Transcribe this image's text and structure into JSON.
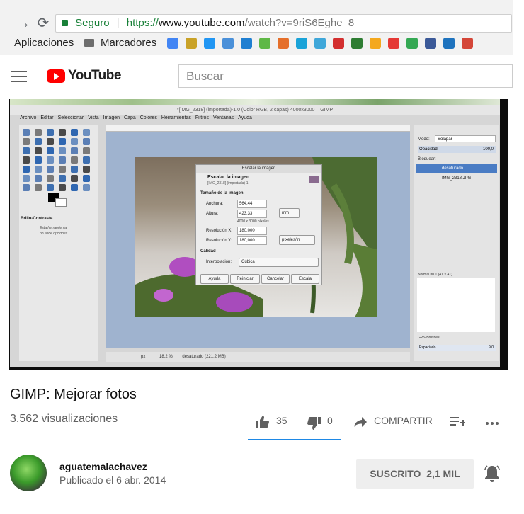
{
  "browser": {
    "secure_label": "Seguro",
    "url_scheme": "https://",
    "url_host": "www.youtube.com",
    "url_path": "/watch?v=9riS6Eghe_8",
    "bookmarks": [
      "Aplicaciones",
      "Marcadores"
    ],
    "bookmark_icon_colors": [
      "#4285f4",
      "#c9a227",
      "#2196f3",
      "#4a90d9",
      "#1f7fd1",
      "#5fb846",
      "#e56f2a",
      "#1aa3d8",
      "#3fa7d9",
      "#d32f2f",
      "#2e7d32",
      "#f4a81d",
      "#e53935",
      "#34a853",
      "#3b5998",
      "#1e73be",
      "#d44638"
    ]
  },
  "youtube": {
    "brand": "YouTube",
    "search_placeholder": "Buscar"
  },
  "gimp": {
    "window_title": "*[IMG_2318] (importada)-1.0 (Color RGB, 2 capas) 4000x3000 – GIMP",
    "menu": [
      "Archivo",
      "Editar",
      "Seleccionar",
      "Vista",
      "Imagen",
      "Capa",
      "Colores",
      "Herramientas",
      "Filtros",
      "Ventanas",
      "Ayuda"
    ],
    "tool_options_title": "Brillo-Contraste",
    "tool_options_note": [
      "Esta herramienta",
      "no tiene opciones."
    ],
    "dialog": {
      "title": "Escalar la imagen",
      "heading": "Escalar la imagen",
      "sub": "[IMG_2318] (importada)-1",
      "section_size": "Tamaño de la imagen",
      "width_label": "Anchura:",
      "width_value": "564,44",
      "height_label": "Altura:",
      "height_value": "423,33",
      "unit": "mm",
      "pixels_note": "4000 x 3000 píxeles",
      "xres_label": "Resolución X:",
      "xres_value": "180,000",
      "yres_label": "Resolución Y:",
      "yres_value": "180,000",
      "res_unit": "píxeles/in",
      "section_quality": "Calidad",
      "interp_label": "Interpolación:",
      "interp_value": "Cúbica",
      "buttons": [
        "Ayuda",
        "Reiniciar",
        "Cancelar",
        "Escala"
      ]
    },
    "layers": {
      "mode_label": "Modo:",
      "mode_value": "Solapar",
      "opacity_label": "Opacidad",
      "opacity_value": "100,0",
      "lock_label": "Bloquear:",
      "items": [
        "desaturado",
        "IMG_2318.JPG"
      ]
    },
    "brush_label": "Normal hb 1 (41 × 41)",
    "brush_set": "GPS-Brushes",
    "spacing_label": "Espaciado",
    "spacing_value": "9,0",
    "status_unit": "px",
    "status_zoom": "18,2 %",
    "status_text": "desaturado (221,2 MB)"
  },
  "video": {
    "title": "GIMP: Mejorar fotos",
    "views": "3.562 visualizaciones",
    "likes": "35",
    "dislikes": "0",
    "share_label": "COMPARTIR"
  },
  "channel": {
    "name": "aguatemalachavez",
    "published": "Publicado el 6 abr. 2014",
    "subscribe_label": "SUSCRITO",
    "subscriber_count": "2,1 MIL"
  }
}
